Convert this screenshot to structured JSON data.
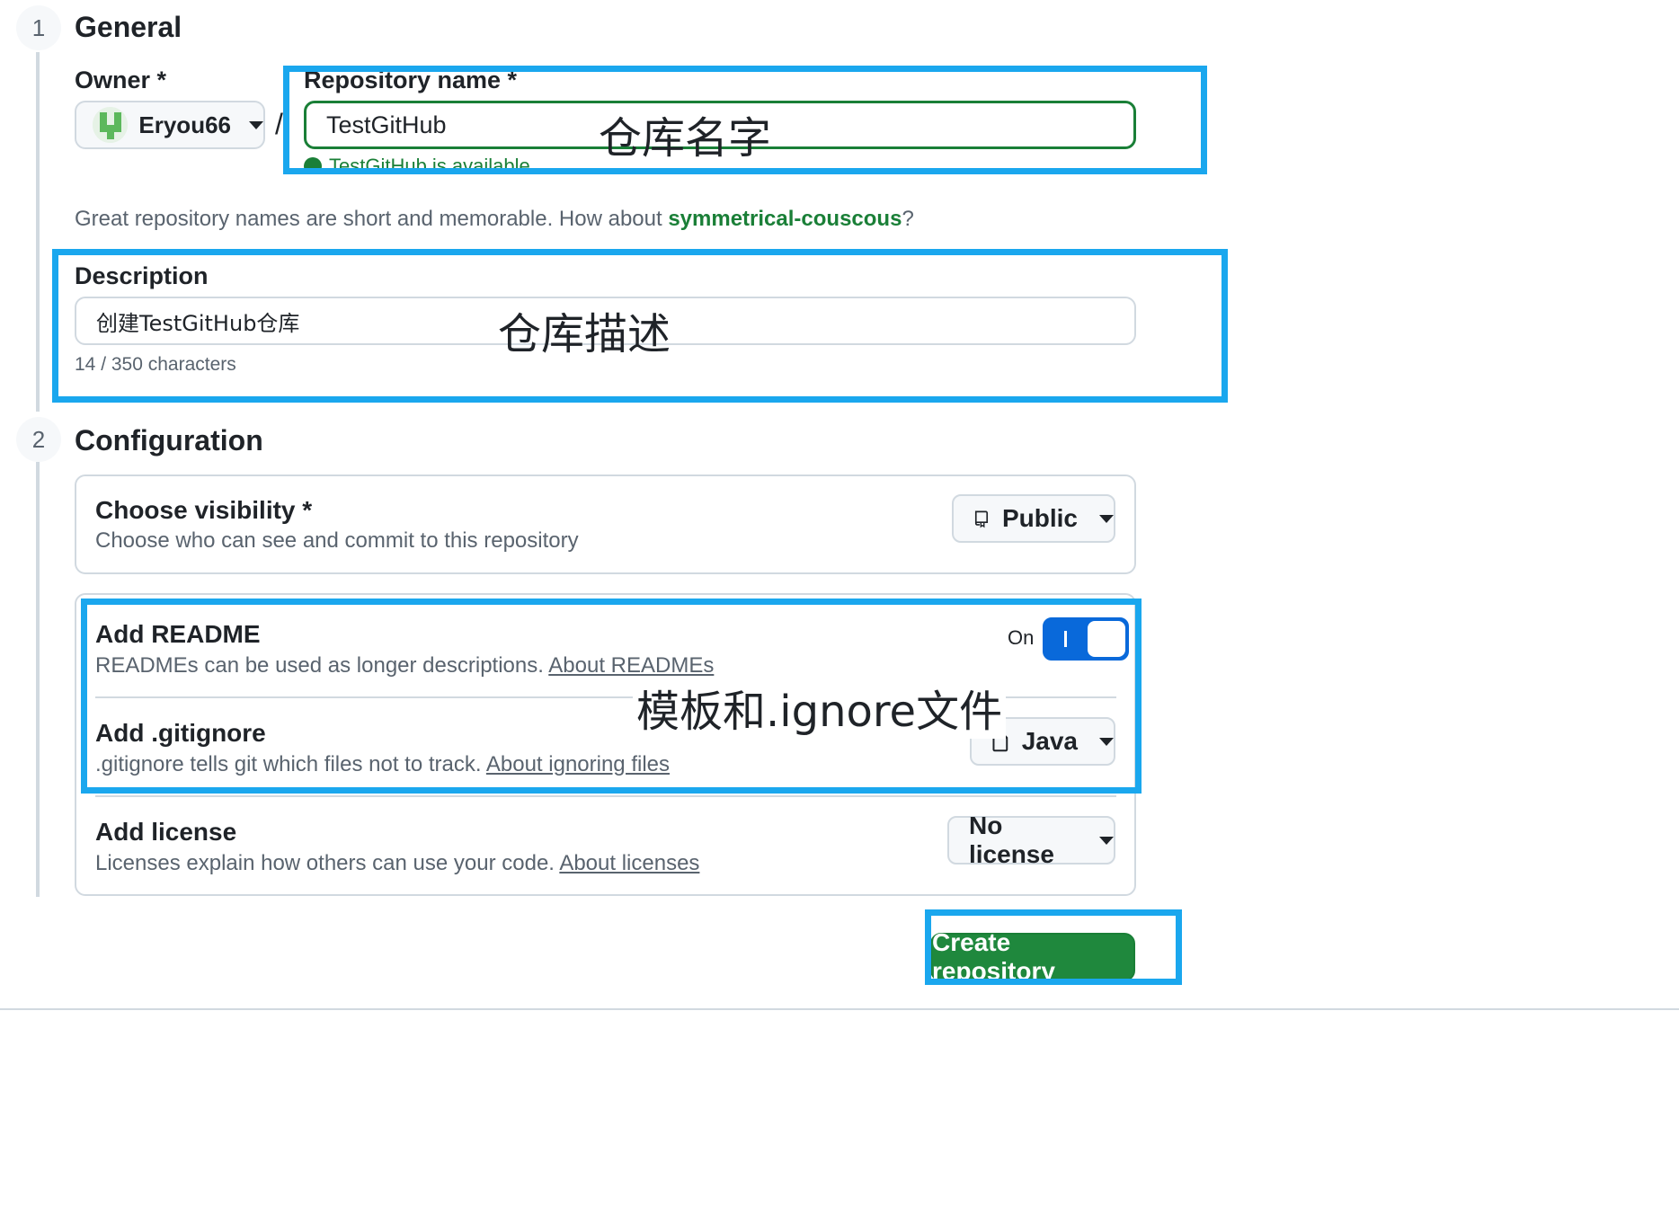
{
  "general": {
    "step_number": "1",
    "title": "General",
    "owner_label": "Owner *",
    "owner_value": "Eryou66",
    "slash": "/",
    "repo_name_label": "Repository name *",
    "repo_name_value": "TestGitHub",
    "availability": "TestGitHub is available.",
    "suggestion_prefix": "Great repository names are short and memorable. How about ",
    "suggestion_name": "symmetrical-couscous",
    "suggestion_suffix": "?",
    "description_label": "Description",
    "description_value": "创建TestGitHub仓库",
    "char_count": "14 / 350 characters"
  },
  "configuration": {
    "step_number": "2",
    "title": "Configuration",
    "visibility_title": "Choose visibility *",
    "visibility_desc": "Choose who can see and commit to this repository",
    "visibility_value": "Public",
    "readme_title": "Add README",
    "readme_desc": "READMEs can be used as longer descriptions. ",
    "readme_link": "About READMEs",
    "readme_toggle_label": "On",
    "readme_enabled": true,
    "gitignore_title": "Add .gitignore",
    "gitignore_desc": ".gitignore tells git which files not to track. ",
    "gitignore_link": "About ignoring files",
    "gitignore_value": "Java",
    "license_title": "Add license",
    "license_desc": "Licenses explain how others can use your code. ",
    "license_link": "About licenses",
    "license_value": "No license"
  },
  "create_button": "Create repository",
  "annotations": {
    "repo_name": "仓库名字",
    "description": "仓库描述",
    "template": "模板和.ignore文件"
  },
  "icons": {
    "visibility": "repo-icon",
    "gitignore": "file-icon",
    "dropdown": "triangle-down-icon",
    "availability": "check-circle-icon"
  },
  "colors": {
    "accent_blue": "#0969da",
    "success_green": "#1a7f37",
    "primary_button": "#1f883d",
    "annotation": "#1aa7ee"
  }
}
